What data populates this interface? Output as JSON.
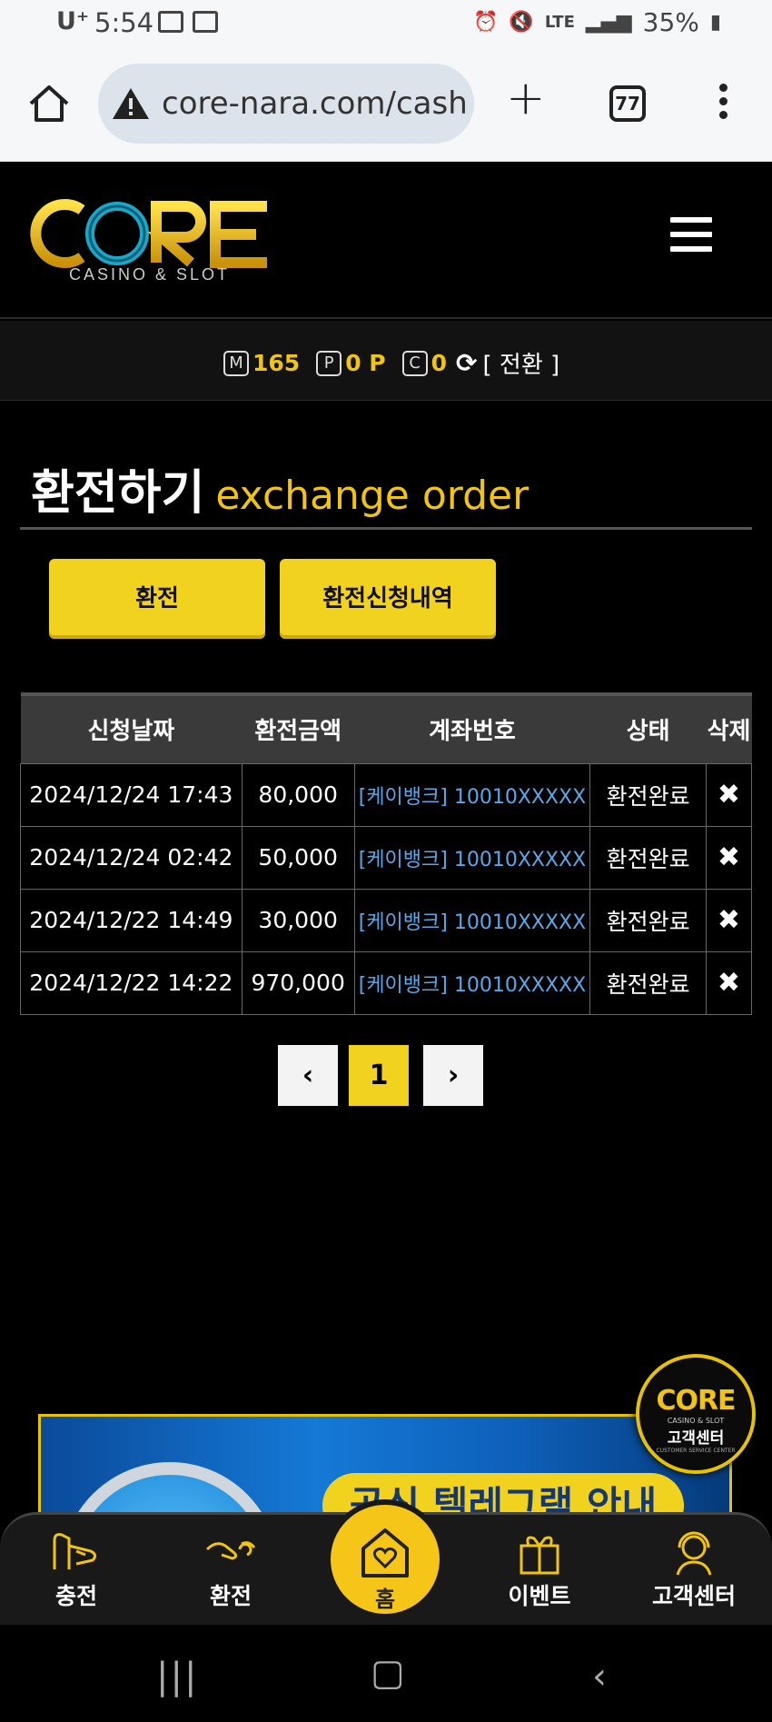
{
  "status_bar": {
    "carrier": "U⁺",
    "time": "5:54",
    "battery": "35%",
    "network": "LTE"
  },
  "browser": {
    "url": "core-nara.com/cash",
    "tab_count": "77"
  },
  "logo": {
    "main": "CORE",
    "sub": "CASINO & SLOT"
  },
  "balance": {
    "money_icon": "M",
    "money": "165",
    "point_icon": "P",
    "point": "0 P",
    "coin_icon": "C",
    "coin": "0",
    "convert_label": "[ 전환 ]"
  },
  "title": {
    "ko": "환전하기",
    "en": "exchange order"
  },
  "buttons": {
    "exchange": "환전",
    "history": "환전신청내역"
  },
  "table": {
    "headers": [
      "신청날짜",
      "환전금액",
      "계좌번호",
      "상태",
      "삭제"
    ],
    "rows": [
      {
        "date": "2024/12/24 17:43",
        "amount": "80,000",
        "account": "[케이뱅크] 10010XXXXX",
        "status": "환전완료",
        "delete": "✖"
      },
      {
        "date": "2024/12/24 02:42",
        "amount": "50,000",
        "account": "[케이뱅크] 10010XXXXX",
        "status": "환전완료",
        "delete": "✖"
      },
      {
        "date": "2024/12/22 14:49",
        "amount": "30,000",
        "account": "[케이뱅크] 10010XXXXX",
        "status": "환전완료",
        "delete": "✖"
      },
      {
        "date": "2024/12/22 14:22",
        "amount": "970,000",
        "account": "[케이뱅크] 10010XXXXX",
        "status": "환전완료",
        "delete": "✖"
      }
    ]
  },
  "pagination": {
    "prev": "‹",
    "current": "1",
    "next": "›"
  },
  "banner": {
    "text": "공식 텔레그램 안내"
  },
  "cs_float": {
    "logo": "CORE",
    "sub": "CASINO & SLOT",
    "label": "고객센터",
    "en": "CUSTOMER SERVICE CENTER"
  },
  "bottom_nav": {
    "deposit": "충전",
    "exchange": "환전",
    "home": "홈",
    "event": "이벤트",
    "support": "고객센터"
  },
  "colors": {
    "accent": "#f1d21e",
    "gold": "#f1c40f",
    "link": "#5ba7e6"
  }
}
